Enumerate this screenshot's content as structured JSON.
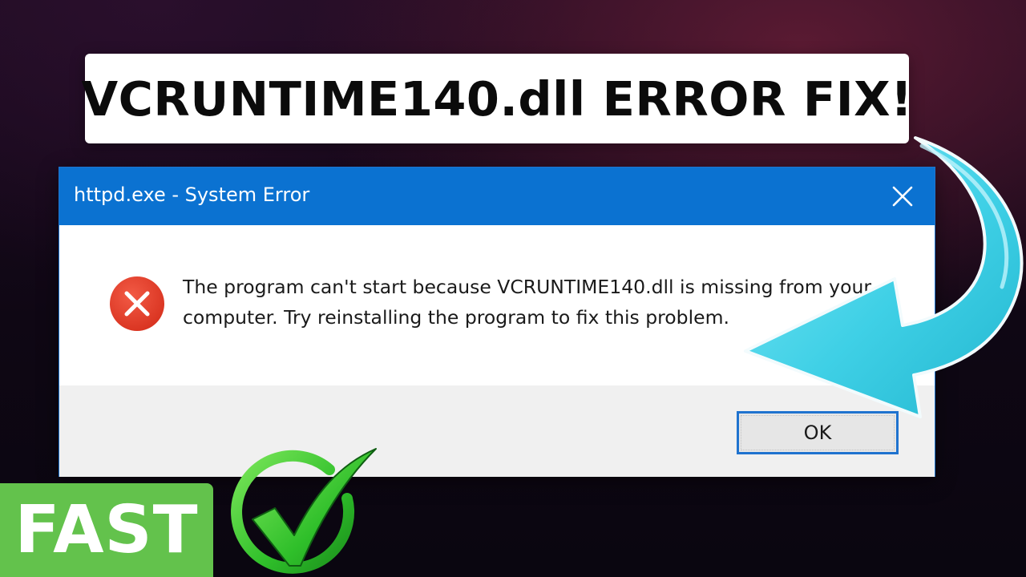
{
  "headline": {
    "text": "VCRUNTIME140.dll ERROR FIX!"
  },
  "dialog": {
    "title": "httpd.exe - System Error",
    "message": "The program can't start because VCRUNTIME140.dll is missing from your computer. Try reinstalling the program to fix this problem.",
    "ok_label": "OK",
    "close_icon": "close-icon",
    "status_icon": "error-icon"
  },
  "badge": {
    "text": "FAST"
  },
  "decorations": {
    "arrow_icon": "arrow-icon",
    "check_icon": "checkmark-icon"
  },
  "colors": {
    "titlebar": "#0b72d1",
    "error_red": "#e8402f",
    "ok_border": "#1f73cf",
    "badge_green": "#63c24c",
    "arrow_cyan": "#3fd0e6",
    "check_green": "#2fbf2a"
  }
}
